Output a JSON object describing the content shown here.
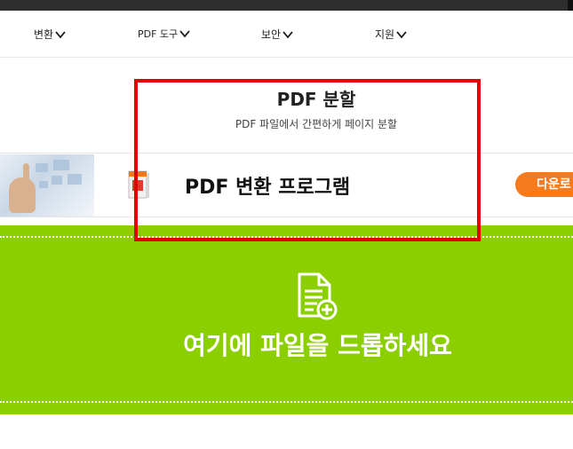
{
  "nav": {
    "items": [
      {
        "label": "변환"
      },
      {
        "label": "PDF 도구"
      },
      {
        "label": "보안"
      },
      {
        "label": "지원"
      }
    ]
  },
  "header": {
    "title": "PDF 분할",
    "subtitle": "PDF 파일에서 간편하게 페이지 분할"
  },
  "ad": {
    "title": "PDF 변환 프로그램",
    "download_label": "다운로"
  },
  "dropzone": {
    "label": "여기에 파일을 드롭하세요"
  },
  "colors": {
    "accent_green": "#8ccf00",
    "download_orange": "#f77b1c",
    "highlight_red": "#e10000"
  }
}
